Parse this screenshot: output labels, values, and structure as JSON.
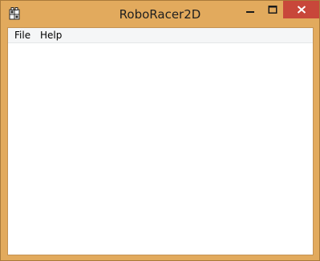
{
  "window": {
    "title": "RoboRacer2D",
    "frame_color": "#e2aa5d",
    "close_button_color": "#c8473a"
  },
  "title_controls": {
    "minimize_icon": "minimize-icon",
    "maximize_icon": "maximize-icon",
    "close_icon": "close-icon"
  },
  "app_icon": "app-icon",
  "menu": {
    "items": [
      {
        "label": "File"
      },
      {
        "label": "Help"
      }
    ]
  }
}
